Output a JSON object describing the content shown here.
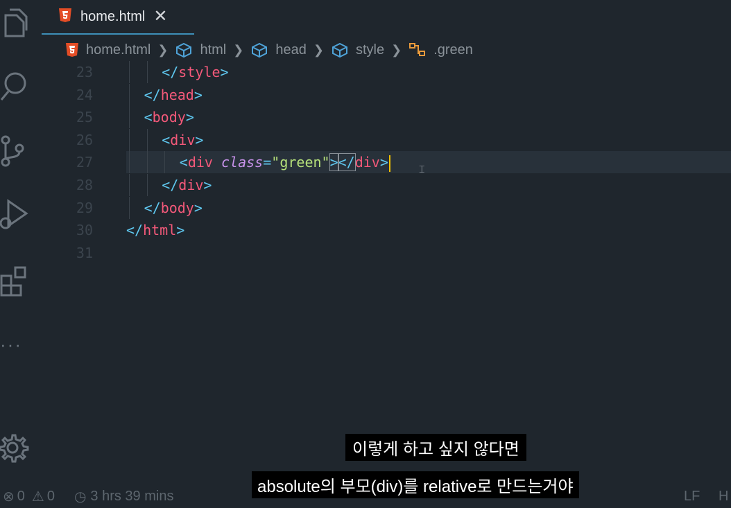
{
  "tab": {
    "title": "home.html",
    "close_glyph": "✕"
  },
  "breadcrumb": [
    {
      "label": "home.html",
      "icon": "html5-icon"
    },
    {
      "label": "html",
      "icon": "symbol-box-icon"
    },
    {
      "label": "head",
      "icon": "symbol-box-icon"
    },
    {
      "label": "style",
      "icon": "symbol-box-icon"
    },
    {
      "label": ".green",
      "icon": "css-class-icon"
    }
  ],
  "activity_icons": [
    "explorer-icon",
    "search-icon",
    "source-control-icon",
    "run-debug-icon",
    "extensions-icon",
    "more-icon",
    "settings-gear-icon"
  ],
  "editor": {
    "lines": [
      {
        "num": "23",
        "parts": [
          [
            "br",
            "</"
          ],
          [
            "tag",
            "style"
          ],
          [
            "br",
            ">"
          ]
        ],
        "indent": 2
      },
      {
        "num": "24",
        "parts": [
          [
            "br",
            "</"
          ],
          [
            "tag",
            "head"
          ],
          [
            "br",
            ">"
          ]
        ],
        "indent": 1
      },
      {
        "num": "25",
        "parts": [
          [
            "br",
            "<"
          ],
          [
            "tag",
            "body"
          ],
          [
            "br",
            ">"
          ]
        ],
        "indent": 1
      },
      {
        "num": "26",
        "parts": [
          [
            "br",
            "<"
          ],
          [
            "tag",
            "div"
          ],
          [
            "br",
            ">"
          ]
        ],
        "indent": 2
      },
      {
        "num": "27",
        "parts": [
          [
            "br",
            "<"
          ],
          [
            "tag",
            "div"
          ],
          [
            "sp",
            " "
          ],
          [
            "attr",
            "class"
          ],
          [
            "eq",
            "="
          ],
          [
            "str",
            "\"green\""
          ],
          [
            "br",
            ">"
          ],
          [
            "br",
            "</"
          ],
          [
            "tag",
            "div"
          ],
          [
            "br",
            ">"
          ]
        ],
        "indent": 3
      },
      {
        "num": "28",
        "parts": [
          [
            "br",
            "</"
          ],
          [
            "tag",
            "div"
          ],
          [
            "br",
            ">"
          ]
        ],
        "indent": 2
      },
      {
        "num": "29",
        "parts": [
          [
            "br",
            "</"
          ],
          [
            "tag",
            "body"
          ],
          [
            "br",
            ">"
          ]
        ],
        "indent": 1
      },
      {
        "num": "30",
        "parts": [
          [
            "br",
            "</"
          ],
          [
            "tag",
            "html"
          ],
          [
            "br",
            ">"
          ]
        ],
        "indent": 0
      },
      {
        "num": "31",
        "parts": [],
        "indent": 0
      }
    ],
    "active_line": "27"
  },
  "statusbar": {
    "errors": "0",
    "warnings": "0",
    "time": "3 hrs 39 mins",
    "eol": "LF",
    "lang_partial": "H"
  },
  "subtitles": {
    "line1": "이렇게 하고 싶지 않다면",
    "line2": "absolute의 부모(div)를 relative로 만드는거야"
  },
  "colors": {
    "background": "#1f262d",
    "tag": "#f4597a",
    "bracket": "#5fc8f0",
    "string": "#b5e07a",
    "attr": "#c792ea",
    "accent": "#3d8fb8"
  }
}
